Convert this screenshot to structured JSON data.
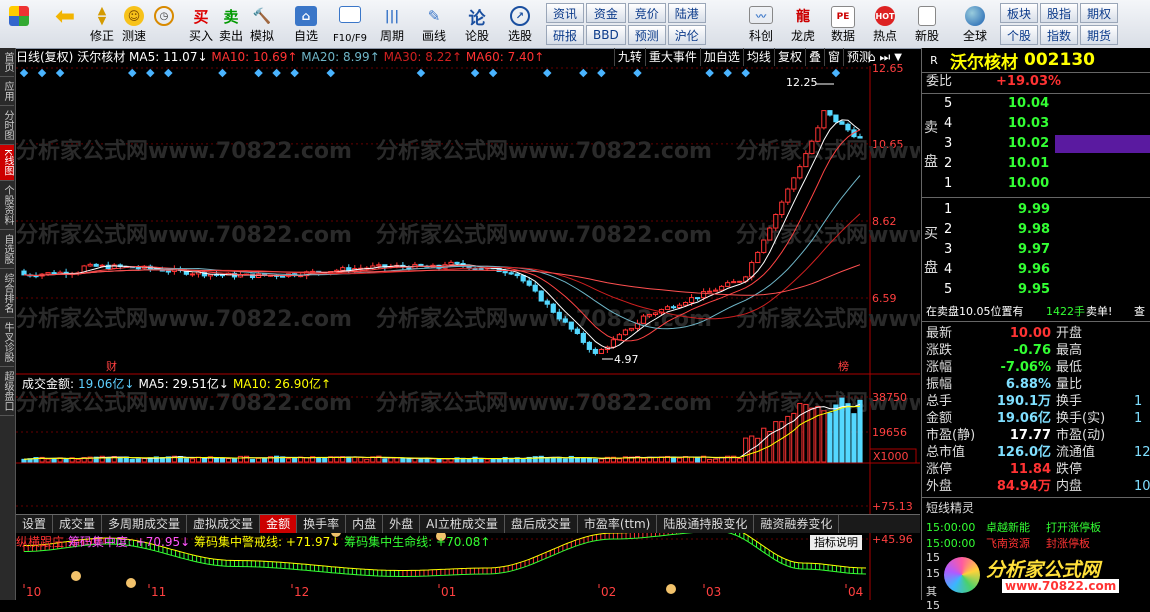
{
  "toolbar": {
    "buttons": [
      {
        "label": "",
        "icon": "grid-icon"
      },
      {
        "label": "",
        "icon": "back-arrow-icon"
      },
      {
        "label": "修正",
        "icon": "up-down-icon"
      },
      {
        "label": "测速",
        "icon": "smiley-icon"
      },
      {
        "label": "",
        "icon": "clock-icon"
      },
      {
        "label": "买入",
        "icon": "buy-icon"
      },
      {
        "label": "卖出",
        "icon": "sell-icon"
      },
      {
        "label": "模拟",
        "icon": "hammer-icon"
      },
      {
        "label": "自选",
        "icon": "home-icon"
      },
      {
        "label": "F10/F9",
        "icon": "f10-icon"
      },
      {
        "label": "周期",
        "icon": "cycle-icon"
      },
      {
        "label": "画线",
        "icon": "pen-icon"
      },
      {
        "label": "论股",
        "icon": "discuss-icon"
      },
      {
        "label": "选股",
        "icon": "select-icon"
      },
      {
        "label": "科创",
        "icon": "kechuang-icon"
      },
      {
        "label": "龙虎",
        "icon": "dragon-icon"
      },
      {
        "label": "数据",
        "icon": "pe-icon"
      },
      {
        "label": "热点",
        "icon": "hot-icon"
      },
      {
        "label": "新股",
        "icon": "newstock-icon"
      },
      {
        "label": "全球",
        "icon": "globe-icon"
      }
    ],
    "grid1": [
      "资讯",
      "研报",
      "资金",
      "BBD",
      "竞价",
      "预测",
      "陆港",
      "沪伦"
    ],
    "grid2": [
      "板块",
      "个股",
      "股指",
      "指数",
      "期权",
      "期货"
    ],
    "icon_texts": {
      "buy": "买",
      "sell": "卖",
      "discuss": "论",
      "pe": "PE",
      "hot": "HOT"
    }
  },
  "sidebar": {
    "items": [
      "首页",
      "应用",
      "分时图",
      "K线图",
      "个股资料",
      "自选股",
      "综合排名",
      "牛叉诊股",
      "超级盘口"
    ],
    "active_index": 3
  },
  "chart": {
    "ma_legend": {
      "period": "日线(复权)",
      "name": "沃尔核材",
      "ma5": "MA5: 11.07↓",
      "ma10": "MA10: 10.69↑",
      "ma20": "MA20: 8.99↑",
      "ma30": "MA30: 8.22↑",
      "ma60": "MA60: 7.40↑"
    },
    "tools": [
      "九转",
      "重大事件",
      "加自选",
      "均线",
      "复权",
      "叠",
      "窗",
      "预测"
    ],
    "price_axis": [
      "12.65",
      "10.65",
      "8.62",
      "6.59"
    ],
    "high_label": "12.25",
    "low_label": "4.97",
    "badge_cai": "财",
    "badge_bang": "榜",
    "watermark": "分析家公式网www.70822.com",
    "colors": {
      "up": "#ff3333",
      "down": "#54d8ff",
      "ma5": "#ffffff",
      "ma10": "#ff4444",
      "ma20": "#6fb6c8",
      "ma30": "#d02020",
      "ma60": "#ff5050"
    }
  },
  "volume": {
    "legend": {
      "name": "成交金额:",
      "value": "19.06亿↓",
      "ma5": "MA5: 29.51亿↓",
      "ma10": "MA10: 26.90亿↑"
    },
    "axis": [
      "38750",
      "19656"
    ],
    "unit": "X1000"
  },
  "tabs": {
    "items": [
      "设置",
      "成交量",
      "多周期成交量",
      "虚拟成交量",
      "金额",
      "换手率",
      "内盘",
      "外盘",
      "AI立桩成交量",
      "盘后成交量",
      "市盈率(ttm)",
      "陆股通持股变化",
      "融资融券变化"
    ],
    "active_index": 4
  },
  "indicator": {
    "legend": {
      "name": "纵横跟庄",
      "l1": "筹码集中度: +70.95↓",
      "l2": "筹码集中警戒线: +71.97↓",
      "l3": "筹码集中生命线: +70.08↑"
    },
    "button": "指标说明",
    "axis": [
      "+75.13",
      "+45.96"
    ],
    "x_labels": [
      "10",
      "11",
      "12",
      "01",
      "02",
      "03",
      "04"
    ]
  },
  "quote": {
    "marker": "R",
    "name": "沃尔核材",
    "code": "002130",
    "weibi_label": "委比",
    "weibi_value": "+19.03%",
    "sell_label": [
      "卖",
      "盘"
    ],
    "buy_label": [
      "买",
      "盘"
    ],
    "sell": [
      {
        "n": "5",
        "p": "10.04",
        "v": ""
      },
      {
        "n": "4",
        "p": "10.03",
        "v": ""
      },
      {
        "n": "3",
        "p": "10.02",
        "v": ""
      },
      {
        "n": "2",
        "p": "10.01",
        "v": ""
      },
      {
        "n": "1",
        "p": "10.00",
        "v": ""
      }
    ],
    "buy": [
      {
        "n": "1",
        "p": "9.99",
        "v": ""
      },
      {
        "n": "2",
        "p": "9.98",
        "v": ""
      },
      {
        "n": "3",
        "p": "9.97",
        "v": ""
      },
      {
        "n": "4",
        "p": "9.96",
        "v": ""
      },
      {
        "n": "5",
        "p": "9.95",
        "v": ""
      }
    ],
    "notice": "在卖盘10.05位置有",
    "notice_vol": "1422手",
    "notice_action": "卖单!",
    "notice_more": "查",
    "stats": [
      {
        "l": "最新",
        "v": "10.00",
        "c": "red",
        "l2": "开盘",
        "v2": ""
      },
      {
        "l": "涨跌",
        "v": "-0.76",
        "c": "green",
        "l2": "最高",
        "v2": ""
      },
      {
        "l": "涨幅",
        "v": "-7.06%",
        "c": "green",
        "l2": "最低",
        "v2": ""
      },
      {
        "l": "振幅",
        "v": "6.88%",
        "c": "cyan",
        "l2": "量比",
        "v2": ""
      },
      {
        "l": "总手",
        "v": "190.1万",
        "c": "cyan",
        "l2": "换手",
        "v2": "1"
      },
      {
        "l": "金额",
        "v": "19.06亿",
        "c": "cyan",
        "l2": "换手(实)",
        "v2": "1"
      },
      {
        "l": "市盈(静)",
        "v": "17.77",
        "c": "white",
        "l2": "市盈(动)",
        "v2": ""
      },
      {
        "l": "总市值",
        "v": "126.0亿",
        "c": "cyan",
        "l2": "流通值",
        "v2": "12"
      },
      {
        "l": "涨停",
        "v": "11.84",
        "c": "red",
        "l2": "跌停",
        "v2": ""
      },
      {
        "l": "外盘",
        "v": "84.94万",
        "c": "red",
        "l2": "内盘",
        "v2": "10"
      }
    ],
    "news_title": "短线精灵",
    "news": [
      {
        "t": "15:00:00",
        "n": "卓越新能",
        "e": "打开涨停板",
        "c": "green"
      },
      {
        "t": "15:00:00",
        "n": "飞南资源",
        "e": "封涨停板",
        "c": "red"
      }
    ],
    "news_more": [
      "15",
      "15",
      "其",
      "15"
    ],
    "logo": "分析家公式网",
    "logo_url": "www.70822.com"
  }
}
